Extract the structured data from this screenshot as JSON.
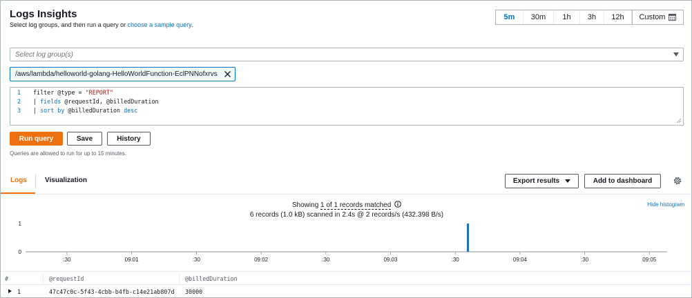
{
  "header": {
    "title": "Logs Insights",
    "subtitle_prefix": "Select log groups, and then run a query or ",
    "subtitle_link": "choose a sample query",
    "subtitle_suffix": "."
  },
  "time_range": {
    "options": [
      "5m",
      "30m",
      "1h",
      "3h",
      "12h"
    ],
    "selected": "5m",
    "custom_label": "Custom"
  },
  "log_group_select": {
    "placeholder": "Select log group(s)",
    "selected_group": "/aws/lambda/helloworld-golang-HelloWorldFunction-EclPNNofxrvs"
  },
  "query_editor": {
    "lines": [
      {
        "number": "1",
        "parts": [
          {
            "t": "filter @type = ",
            "c": ""
          },
          {
            "t": "\"REPORT\"",
            "c": "str"
          }
        ]
      },
      {
        "number": "2",
        "parts": [
          {
            "t": "| ",
            "c": ""
          },
          {
            "t": "fields",
            "c": "kw"
          },
          {
            "t": " @requestId, @billedDuration",
            "c": ""
          }
        ]
      },
      {
        "number": "3",
        "parts": [
          {
            "t": "| ",
            "c": ""
          },
          {
            "t": "sort by",
            "c": "kw"
          },
          {
            "t": " @billedDuration ",
            "c": ""
          },
          {
            "t": "desc",
            "c": "kw"
          }
        ]
      }
    ]
  },
  "actions": {
    "run_label": "Run query",
    "save_label": "Save",
    "history_label": "History",
    "note": "Queries are allowed to run for up to 15 minutes."
  },
  "results_tabs": {
    "logs_label": "Logs",
    "visualization_label": "Visualization",
    "active": "Logs",
    "export_label": "Export results",
    "dashboard_label": "Add to dashboard"
  },
  "status": {
    "showing_prefix": "Showing ",
    "matched_text": "1 of 1 records matched",
    "scan_summary": "6 records (1.0 kB) scanned in 2.4s @ 2 records/s (432.398 B/s)",
    "hide_histogram": "Hide histogram"
  },
  "chart_data": {
    "type": "bar",
    "y_ticks": [
      "1",
      "0"
    ],
    "ylim": [
      0,
      1
    ],
    "x_tick_labels": [
      ":30",
      "09:01",
      ":30",
      "09:02",
      ":30",
      "09:03",
      ":30",
      "09:04",
      ":30",
      "09:05"
    ],
    "bars": [
      {
        "x_fraction": 0.6895,
        "value": 1
      }
    ],
    "color": "#1f6fb5"
  },
  "table": {
    "columns": [
      "#",
      "@requestId",
      "@billedDuration"
    ],
    "rows": [
      {
        "index": "1",
        "requestId": "47c47c0c-5f43-4cbb-b4fb-c14e21ab807d",
        "billedDuration": "30000"
      }
    ]
  }
}
